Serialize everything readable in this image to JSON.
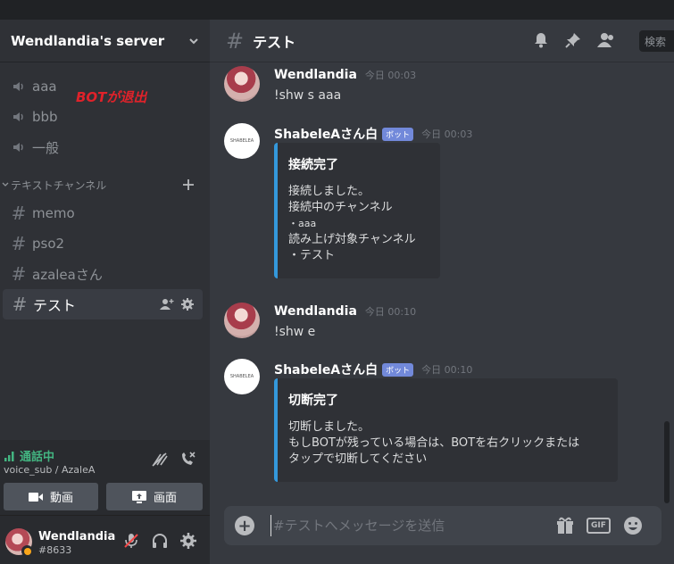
{
  "server": {
    "name": "Wendlandia's server"
  },
  "annotation": "BOTが退出",
  "voice_channels": [
    {
      "label": "aaa"
    },
    {
      "label": "bbb"
    },
    {
      "label": "一般"
    }
  ],
  "category": {
    "label": "テキストチャンネル"
  },
  "text_channels": [
    {
      "label": "memo"
    },
    {
      "label": "pso2"
    },
    {
      "label": "azaleaさん"
    },
    {
      "label": "テスト"
    }
  ],
  "voice_panel": {
    "status": "通話中",
    "sub": "voice_sub / AzaleA",
    "video_label": "動画",
    "screen_label": "画面"
  },
  "user": {
    "name": "Wendlandia",
    "tag": "#8633"
  },
  "channel": {
    "name": "テスト",
    "search_label": "検索"
  },
  "messages": [
    {
      "author": "Wendlandia",
      "time": "今日 00:03",
      "text": "!shw s aaa"
    },
    {
      "author": "ShabeleAさん白",
      "badge": "ボット",
      "time": "今日 00:03",
      "embed": {
        "title": "接続完了",
        "lines": [
          "接続しました。",
          "接続中のチャンネル",
          "・aaa",
          "読み上げ対象チャンネル",
          "・テスト"
        ]
      }
    },
    {
      "author": "Wendlandia",
      "time": "今日 00:10",
      "text": "!shw e"
    },
    {
      "author": "ShabeleAさん白",
      "badge": "ボット",
      "time": "今日 00:10",
      "embed": {
        "title": "切断完了",
        "lines": [
          "切断しました。",
          "もしBOTが残っている場合は、BOTを右クリックまたは",
          "タップで切断してください"
        ]
      }
    }
  ],
  "composer": {
    "placeholder": "#テストへメッセージを送信"
  },
  "colors": {
    "accent": "#7289da",
    "embed_border": "#3498db",
    "voice_green": "#43b581",
    "annotation_red": "#e0222a"
  }
}
